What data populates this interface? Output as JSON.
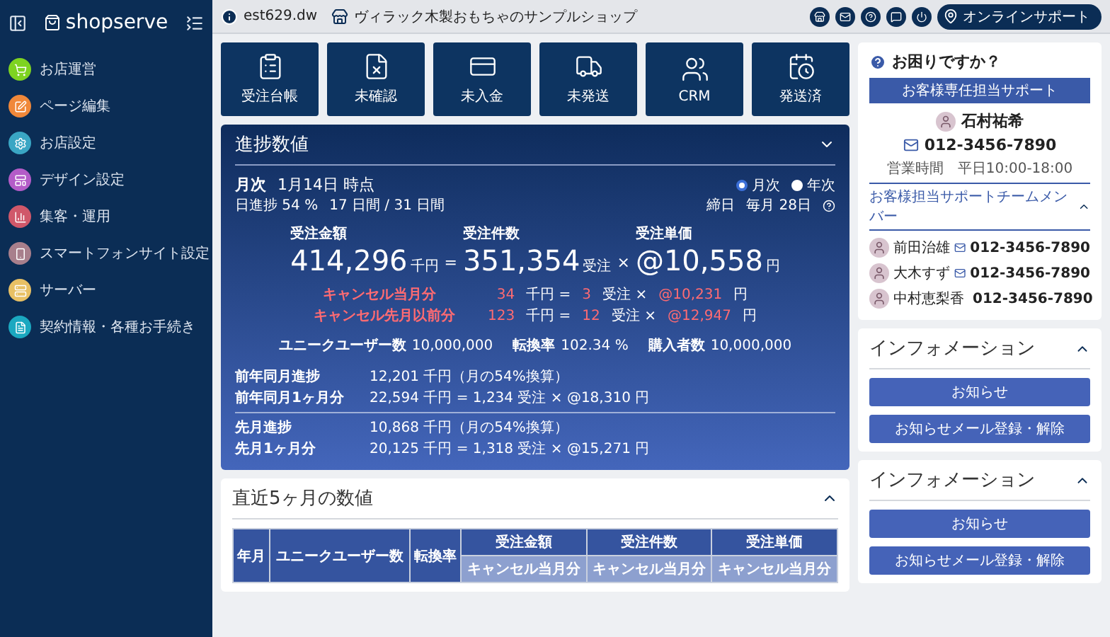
{
  "sidebar": {
    "logo": "shopserve",
    "items": [
      {
        "label": "お店運営",
        "color": "#7ed321"
      },
      {
        "label": "ページ編集",
        "color": "#f0883a"
      },
      {
        "label": "お店設定",
        "color": "#3aa6c4"
      },
      {
        "label": "デザイン設定",
        "color": "#b45cc8"
      },
      {
        "label": "集客・運用",
        "color": "#d0586a"
      },
      {
        "label": "スマートフォンサイト設定",
        "color": "#a87f8c"
      },
      {
        "label": "サーバー",
        "color": "#e8c064"
      },
      {
        "label": "契約情報・各種お手続き",
        "color": "#1ba8c0"
      }
    ]
  },
  "topbar": {
    "account": "est629.dw",
    "shop": "ヴィラック木製おもちゃのサンプルショップ",
    "support_button": "オンラインサポート"
  },
  "tiles": [
    {
      "label": "受注台帳"
    },
    {
      "label": "未確認"
    },
    {
      "label": "未入金"
    },
    {
      "label": "未発送"
    },
    {
      "label": "CRM"
    },
    {
      "label": "発送済"
    }
  ],
  "progress": {
    "title": "進捗数値",
    "period": "月次",
    "date": "1月14日 時点",
    "daily_progress": "日進捗 54 %",
    "days": "17 日間 / 31 日間",
    "radios": [
      {
        "label": "月次",
        "selected": true
      },
      {
        "label": "年次",
        "selected": false
      }
    ],
    "closing_label": "締日",
    "closing_value": "毎月 28日",
    "metrics": [
      {
        "label": "受注金額",
        "value": "414,296",
        "unit": "千円",
        "operator": "="
      },
      {
        "label": "受注件数",
        "value": "351,354",
        "unit": "受注",
        "operator": "×"
      },
      {
        "label": "受注単価",
        "value": "@10,558",
        "unit": "円"
      }
    ],
    "cancels": [
      {
        "label": "キャンセル当月分",
        "amount": "34",
        "amount_unit": "千円 =",
        "count": "3",
        "count_unit": "受注 ×",
        "price": "@10,231",
        "price_unit": "円"
      },
      {
        "label": "キャンセル先月以前分",
        "amount": "123",
        "amount_unit": "千円 =",
        "count": "12",
        "count_unit": "受注 ×",
        "price": "@12,947",
        "price_unit": "円"
      }
    ],
    "stats": [
      {
        "label": "ユニークユーザー数",
        "value": "10,000,000"
      },
      {
        "label": "転換率",
        "value": "102.34 %"
      },
      {
        "label": "購入者数",
        "value": "10,000,000"
      }
    ],
    "comparisons": [
      {
        "label": "前年同月進捗",
        "value": "12,201 千円（月の54%換算）",
        "label_2": "前年同月1ヶ月分",
        "value_2": "22,594 千円 =  1,234 受注 ×  @18,310 円"
      },
      {
        "label": "先月進捗",
        "value": "10,868 千円（月の54%換算）",
        "label_2": "先月1ヶ月分",
        "value_2": "20,125 千円 =  1,318 受注 ×  @15,271 円"
      }
    ]
  },
  "recent": {
    "title": "直近5ヶ月の数値",
    "table": {
      "columns": [
        {
          "label": "年月"
        },
        {
          "label": "ユニークユーザー数"
        },
        {
          "label": "転換率"
        },
        {
          "label": "受注金額",
          "sub": "キャンセル当月分"
        },
        {
          "label": "受注件数",
          "sub": "キャンセル当月分"
        },
        {
          "label": "受注単価",
          "sub": "キャンセル当月分"
        }
      ]
    }
  },
  "help": {
    "title": "お困りですか？",
    "banner": "お客様専任担当サポート",
    "rep_name": "石村祐希",
    "rep_phone": "012-3456-7890",
    "hours": "営業時間　平日10:00-18:00",
    "team_label": "お客様担当サポートチームメンバー",
    "members": [
      {
        "name": "前田治雄",
        "phone": "012-3456-7890"
      },
      {
        "name": "大木すず",
        "phone": "012-3456-7890"
      },
      {
        "name": "中村恵梨香",
        "phone": "012-3456-7890"
      }
    ]
  },
  "info_cards": [
    {
      "title": "インフォメーション",
      "buttons": [
        "お知らせ",
        "お知らせメール登録・解除"
      ]
    },
    {
      "title": "インフォメーション",
      "buttons": [
        "お知らせ",
        "お知らせメール登録・解除"
      ]
    }
  ]
}
